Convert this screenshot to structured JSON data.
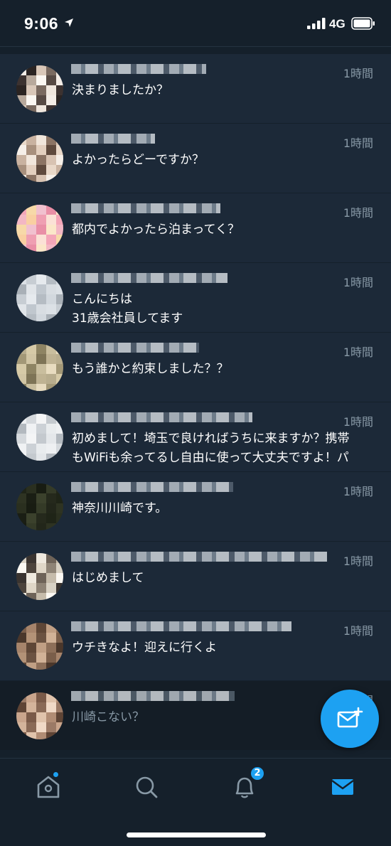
{
  "status_bar": {
    "time": "9:06",
    "network": "4G"
  },
  "messages": [
    {
      "time": "1時間",
      "lines": [
        "決まりましたか？"
      ],
      "avatar_colors": [
        "#f3ece6",
        "#2b2422",
        "#d9c7b8",
        "#7a6a60",
        "#efe6dd",
        "#3c3230",
        "#b8a99c",
        "#fbf7f2",
        "#574a44"
      ]
    },
    {
      "time": "1時間",
      "lines": [
        "よかったらどーですか？"
      ],
      "avatar_colors": [
        "#e9d8c8",
        "#c9b2a0",
        "#f1e6db",
        "#8c7464",
        "#d8c3b2",
        "#f6efe8",
        "#a8907d",
        "#e3cfbe",
        "#5f4a3d"
      ]
    },
    {
      "time": "1時間",
      "lines": [
        "都内でよかったら泊まってく？"
      ],
      "avatar_colors": [
        "#f4a6b8",
        "#f7d9a8",
        "#f1c1cf",
        "#e98fa6",
        "#fbe7c9",
        "#f3b7c4",
        "#f9cfa1",
        "#ef9fb2",
        "#fbe1d6"
      ]
    },
    {
      "time": "1時間",
      "lines": [
        "こんにちは",
        "31歳会社員してます"
      ],
      "avatar_colors": [
        "#dce1e6",
        "#c7cdd3",
        "#e6eaee",
        "#b5bcc3",
        "#d2d8de",
        "#a9b0b7",
        "#e1e5e9",
        "#c0c7ce",
        "#d8dde2"
      ]
    },
    {
      "time": "1時間",
      "lines": [
        "もう誰かと約束しました？？"
      ],
      "avatar_colors": [
        "#b8ad8e",
        "#d6caa7",
        "#8e8463",
        "#c9be9e",
        "#e8dcc0",
        "#a39877",
        "#d1c5a4",
        "#7e7456",
        "#bfb393"
      ]
    },
    {
      "time": "1時間",
      "lines": [
        "初めまして！埼玉で良ければうちに来ますか？携帯",
        "もWiFiも余ってるし自由に使って大丈夫ですよ！パ"
      ],
      "avatar_colors": [
        "#eef0f2",
        "#d5d9dd",
        "#f4f5f6",
        "#c4c9ce",
        "#e4e7ea",
        "#b3b9bf",
        "#f0f2f4",
        "#ccd1d6",
        "#e9ecee"
      ]
    },
    {
      "time": "1時間",
      "lines": [
        "神奈川川崎です。"
      ],
      "avatar_colors": [
        "#1f2417",
        "#2a2f1f",
        "#181c12",
        "#343a27",
        "#22261a",
        "#2e3322",
        "#1a1e14",
        "#3b412c",
        "#25291c"
      ]
    },
    {
      "time": "1時間",
      "lines": [
        "はじめまして"
      ],
      "avatar_colors": [
        "#d9d2c4",
        "#3a3430",
        "#efe9de",
        "#6e6358",
        "#c6bcab",
        "#fbf8f2",
        "#4d443c",
        "#e0d7c7",
        "#8f8476"
      ]
    },
    {
      "time": "1時間",
      "lines": [
        "ウチきなよ！迎えに行くよ"
      ],
      "avatar_colors": [
        "#7a5e4a",
        "#a6846b",
        "#5e4636",
        "#c09f84",
        "#8d6f59",
        "#4a372b",
        "#b39277",
        "#6b5241",
        "#d1b297"
      ]
    },
    {
      "time": "1時間",
      "lines": [
        "川崎こない？"
      ],
      "avatar_colors": [
        "#9b7a66",
        "#c9a58c",
        "#7a5a48",
        "#e0c3ab",
        "#b08c74",
        "#5e4435",
        "#d4b49b",
        "#8a6a56",
        "#f0d9c6"
      ]
    }
  ],
  "tabs": {
    "notifications_badge": "2"
  },
  "colors": {
    "background": "#15202b",
    "row": "#1c2938",
    "accent": "#1da1f2",
    "muted": "#8899a6"
  }
}
